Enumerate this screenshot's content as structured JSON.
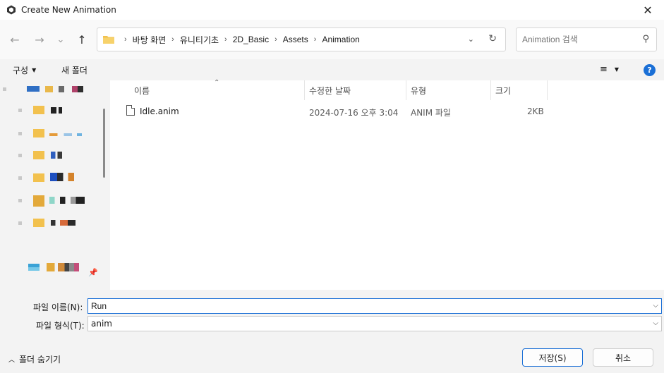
{
  "window": {
    "title": "Create New Animation",
    "close_glyph": "✕"
  },
  "nav": {
    "back_glyph": "←",
    "forward_glyph": "→",
    "recent_glyph": "⌄",
    "up_glyph": "↑"
  },
  "address": {
    "crumbs": [
      "바탕 화면",
      "유니티기초",
      "2D_Basic",
      "Assets",
      "Animation"
    ],
    "separator": "›",
    "dropdown_glyph": "⌄",
    "refresh_glyph": "↻"
  },
  "search": {
    "placeholder": "Animation 검색",
    "icon_glyph": "⚲"
  },
  "commandbar": {
    "organize_label": "구성",
    "new_folder_label": "새 폴더",
    "view_glyph": "≡",
    "help_glyph": "?"
  },
  "columns": {
    "name": "이름",
    "modified": "수정한 날짜",
    "type": "유형",
    "size": "크기"
  },
  "files": [
    {
      "name": "Idle.anim",
      "modified": "2024-07-16 오후 3:04",
      "type": "ANIM 파일",
      "size": "2KB"
    }
  ],
  "form": {
    "filename_label": "파일 이름(N):",
    "filename_value": "Run",
    "filetype_label": "파일 형식(T):",
    "filetype_value": "anim"
  },
  "footer": {
    "hide_folders_label": "폴더 숨기기",
    "save_label": "저장(S)",
    "cancel_label": "취소"
  },
  "colors": {
    "accent": "#1a6fd6",
    "folder": "#f2c14e"
  },
  "icons": {
    "app": "unity-icon",
    "folder": "folder-icon",
    "file": "file-icon",
    "pin": "pin-icon"
  }
}
